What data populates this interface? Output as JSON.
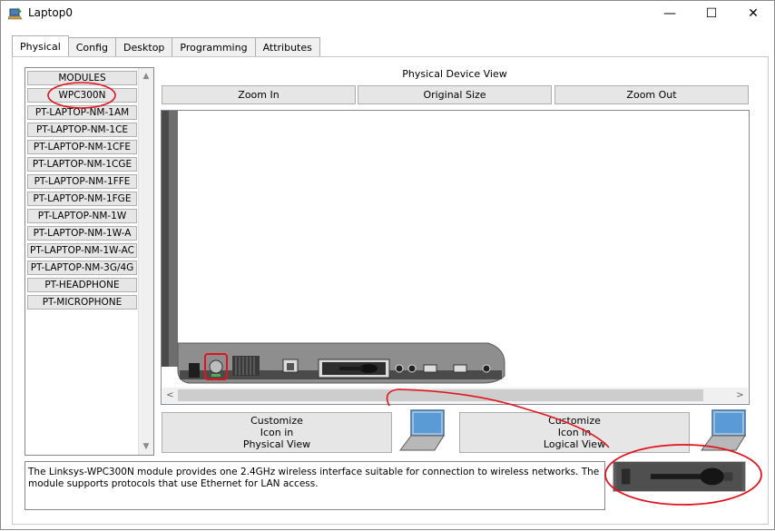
{
  "window": {
    "title": "Laptop0",
    "minimize_glyph": "—",
    "maximize_glyph": "☐",
    "close_glyph": "✕"
  },
  "tabs": [
    {
      "label": "Physical"
    },
    {
      "label": "Config"
    },
    {
      "label": "Desktop"
    },
    {
      "label": "Programming"
    },
    {
      "label": "Attributes"
    }
  ],
  "modules": {
    "items": [
      {
        "label": "MODULES"
      },
      {
        "label": "WPC300N"
      },
      {
        "label": "PT-LAPTOP-NM-1AM"
      },
      {
        "label": "PT-LAPTOP-NM-1CE"
      },
      {
        "label": "PT-LAPTOP-NM-1CFE"
      },
      {
        "label": "PT-LAPTOP-NM-1CGE"
      },
      {
        "label": "PT-LAPTOP-NM-1FFE"
      },
      {
        "label": "PT-LAPTOP-NM-1FGE"
      },
      {
        "label": "PT-LAPTOP-NM-1W"
      },
      {
        "label": "PT-LAPTOP-NM-1W-A"
      },
      {
        "label": "PT-LAPTOP-NM-1W-AC"
      },
      {
        "label": "PT-LAPTOP-NM-3G/4G"
      },
      {
        "label": "PT-HEADPHONE"
      },
      {
        "label": "PT-MICROPHONE"
      }
    ],
    "scroll_up": "▲",
    "scroll_down": "▼"
  },
  "physical_view": {
    "title": "Physical Device View",
    "zoom_in": "Zoom In",
    "original_size": "Original Size",
    "zoom_out": "Zoom Out",
    "scroll_left": "<",
    "scroll_right": ">"
  },
  "customize": {
    "physical": [
      "Customize",
      "Icon in",
      "Physical View"
    ],
    "logical": [
      "Customize",
      "Icon in",
      "Logical View"
    ]
  },
  "description": "The Linksys-WPC300N module provides one 2.4GHz wireless interface suitable for connection to wireless networks. The module supports protocols that use Ethernet for LAN access.",
  "colors": {
    "annotation_red": "#e0141e",
    "laptop_screen_blue": "#5b9bd5"
  }
}
